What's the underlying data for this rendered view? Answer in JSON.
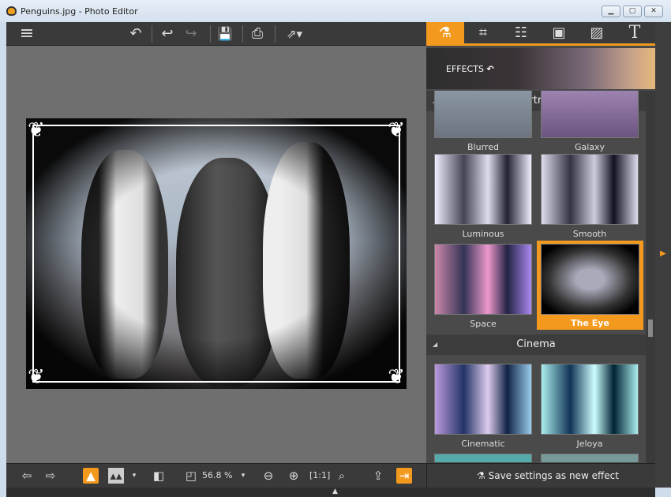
{
  "window": {
    "title": "Penguins.jpg - Photo Editor",
    "minimize": "▁",
    "maximize": "▢",
    "close": "✕"
  },
  "toolbar": {
    "menu": "≡",
    "revert": "↶",
    "undo": "↩",
    "redo": "↪",
    "save": "💾",
    "print": "⎙",
    "share": "⇗▾"
  },
  "panel": {
    "tabs": [
      {
        "name": "effects",
        "glyph": "⚗"
      },
      {
        "name": "crop",
        "glyph": "⌗"
      },
      {
        "name": "adjust",
        "glyph": "☷"
      },
      {
        "name": "frames",
        "glyph": "▣"
      },
      {
        "name": "textures",
        "glyph": "▨"
      },
      {
        "name": "text",
        "glyph": "T"
      }
    ],
    "active_tab": "effects",
    "banner_title": "EFFECTS",
    "banner_back": "↶",
    "sections": [
      {
        "title": "Portrait",
        "items": [
          "Blurred",
          "Galaxy",
          "Luminous",
          "Smooth",
          "Space",
          "The Eye"
        ]
      },
      {
        "title": "Cinema",
        "items": [
          "Cinematic",
          "Jeloya"
        ]
      }
    ],
    "selected_effect": "The Eye",
    "collapse_glyph": "◢"
  },
  "bottom": {
    "prev": "⇦",
    "next": "⇨",
    "zoom": "56.8 %",
    "zoom_dropdown": "▾",
    "save_effect": "Save settings as new effect"
  },
  "colors": {
    "accent": "#f39a1e",
    "toolbar": "#3a3a3a",
    "canvas": "#6f6f6f"
  }
}
